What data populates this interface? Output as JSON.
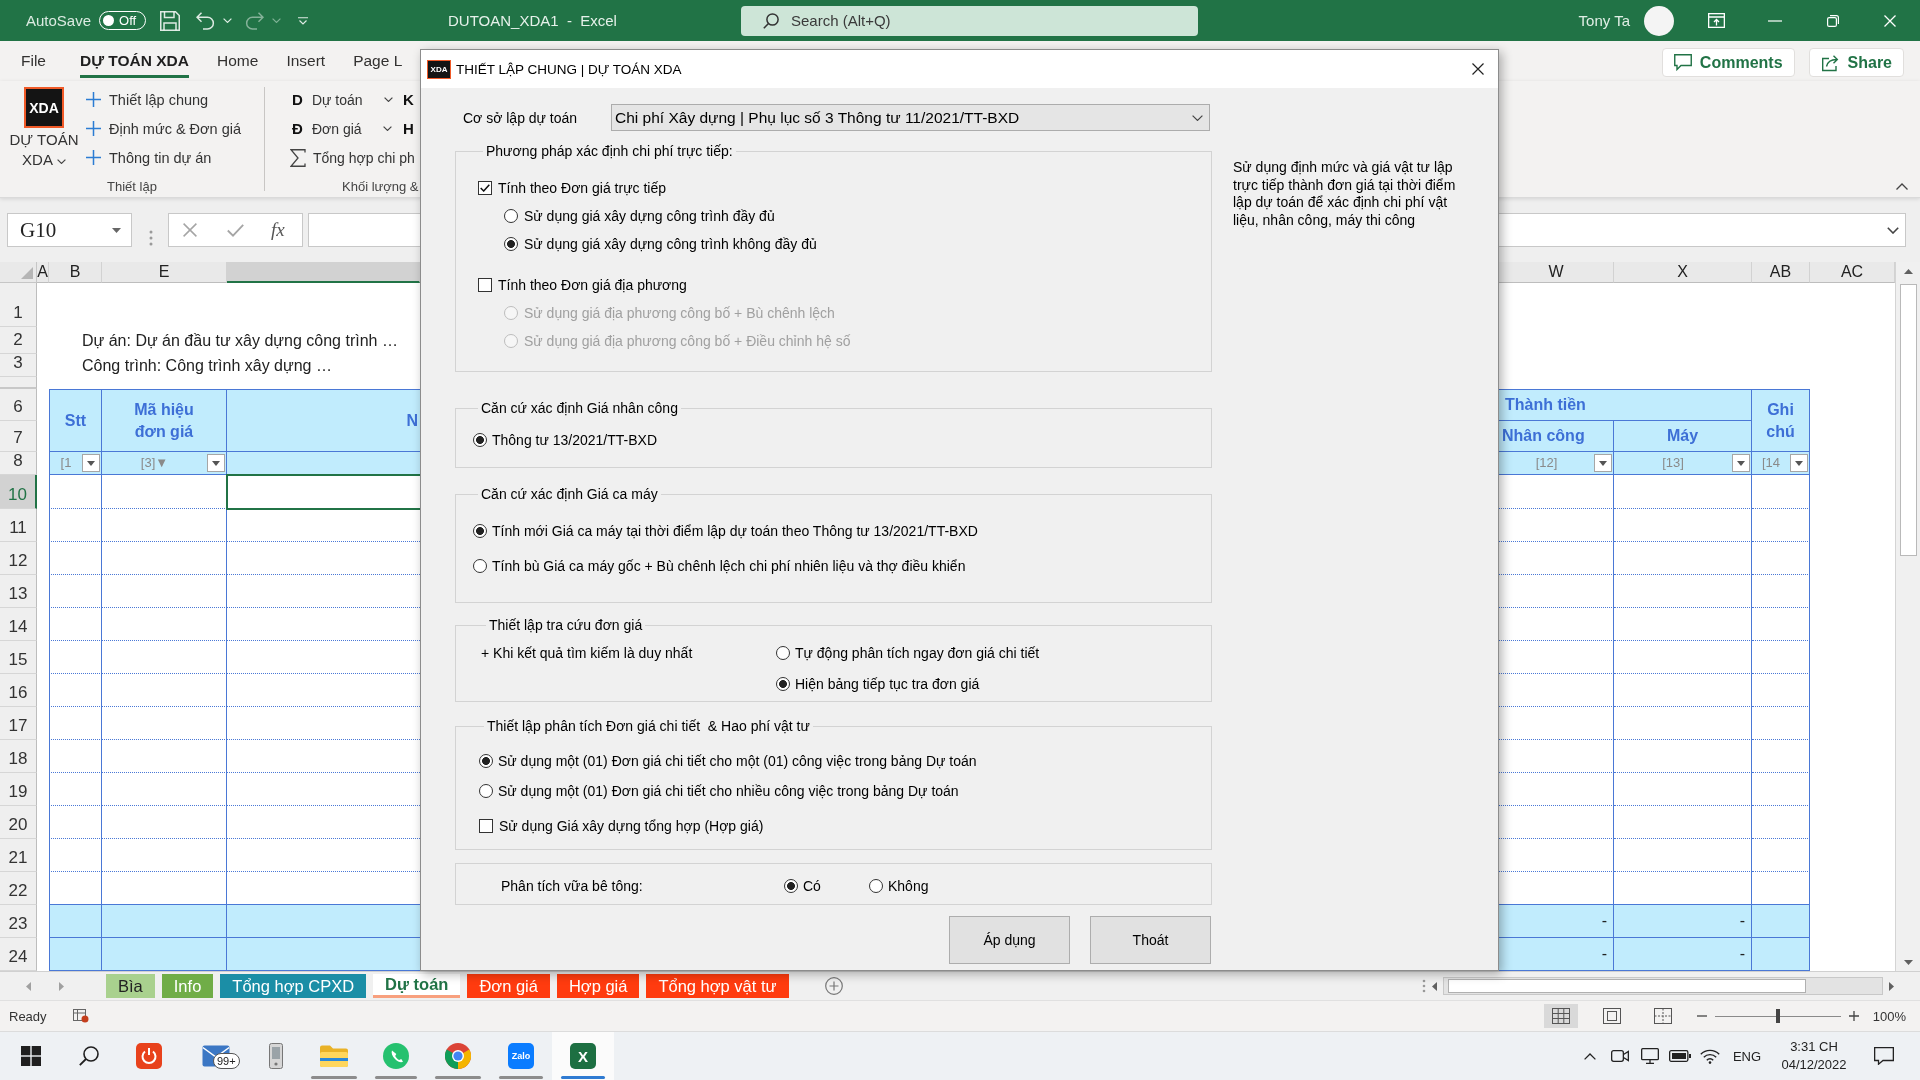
{
  "title_bar": {
    "autosave": {
      "label": "AutoSave",
      "toggle": {
        "label": "Off",
        "on": false
      }
    },
    "title": "DUTOAN_XDA1  -  Excel",
    "search": {
      "placeholder": "Search (Alt+Q)"
    },
    "user": "Tony Ta"
  },
  "ribbon": {
    "tabs": [
      {
        "label": "File",
        "selected": false
      },
      {
        "label": "DỰ TOÁN XDA",
        "selected": true
      },
      {
        "label": "Home",
        "selected": false
      },
      {
        "label": "Insert",
        "selected": false
      },
      {
        "label": "Page L",
        "selected": false
      }
    ],
    "comments_button": "Comments",
    "share_button": "Share",
    "setup_group": {
      "label": "Thiết lập",
      "logo": "XDA",
      "main_button": "DỰ TOÁN XDA",
      "items": [
        "Thiết lập chung",
        "Định mức & Đơn giá",
        "Thông tin dự án"
      ]
    },
    "quantity_group": {
      "label": "Khối lượng &",
      "items": [
        {
          "kind": "letter_menu",
          "letter": "D",
          "label": "Dự toán"
        },
        {
          "kind": "letter_menu",
          "letter": "Đ",
          "label": "Đơn giá"
        },
        {
          "kind": "sum",
          "label": "Tổng hợp chi ph"
        }
      ],
      "next_letters": [
        "K",
        "H"
      ]
    }
  },
  "formula_bar": {
    "name_box": "G10",
    "function_button": "fx"
  },
  "sheet": {
    "column_headers": [
      {
        "label": "A",
        "selected": false
      },
      {
        "label": "B",
        "selected": false
      },
      {
        "label": "E",
        "selected": false
      },
      {
        "selected": true
      },
      {
        "label": "W",
        "selected": false
      },
      {
        "label": "X",
        "selected": false
      },
      {
        "label": "AB",
        "selected": false
      },
      {
        "label": "AC",
        "selected": false
      }
    ],
    "row_headers": [
      {
        "label": "1",
        "selected": false
      },
      {
        "label": "2",
        "selected": false
      },
      {
        "label": "3",
        "selected": false
      },
      {
        "label": "6",
        "selected": false
      },
      {
        "label": "7",
        "selected": false
      },
      {
        "label": "8",
        "selected": false
      },
      {
        "label": "10",
        "selected": true
      },
      {
        "label": "11",
        "selected": false
      },
      {
        "label": "12",
        "selected": false
      },
      {
        "label": "13",
        "selected": false
      },
      {
        "label": "14",
        "selected": false
      },
      {
        "label": "15",
        "selected": false
      },
      {
        "label": "16",
        "selected": false
      },
      {
        "label": "17",
        "selected": false
      },
      {
        "label": "18",
        "selected": false
      },
      {
        "label": "19",
        "selected": false
      },
      {
        "label": "20",
        "selected": false
      },
      {
        "label": "21",
        "selected": false
      },
      {
        "label": "22",
        "selected": false
      },
      {
        "label": "23",
        "selected": false
      },
      {
        "label": "24",
        "selected": false
      }
    ],
    "notes": [
      "Dự án: Dự án đầu tư xây dựng công trình …",
      "Công trình: Công trình xây dựng …"
    ],
    "table": {
      "stt_header": "Stt",
      "code_header": "Mã hiệu đơn giá",
      "task_header": "N",
      "amount_header": "Thành tiền",
      "labor_header": "Nhân công",
      "machine_header": "Máy",
      "note_header": "Ghi chú",
      "column_numbers": [
        "[1",
        "[3]▼",
        "[12]",
        "[13]",
        "[14"
      ],
      "total_rows": [
        {
          "labor": "-",
          "machine": "-"
        },
        {
          "labor": "-",
          "machine": "-"
        }
      ]
    }
  },
  "sheet_tabs": [
    {
      "label": "Bìa",
      "color": "#a9d18e",
      "selected": false
    },
    {
      "label": "Info",
      "color": "#70ad47",
      "selected": false
    },
    {
      "label": "Tổng hợp CPXD",
      "color": "#1b8ea6",
      "selected": false
    },
    {
      "label": "Dự toán",
      "color": "#f8a07e",
      "selected": true
    },
    {
      "label": "Đơn giá",
      "color": "#ff3b0f",
      "selected": false
    },
    {
      "label": "Hợp giá",
      "color": "#ff3b0f",
      "selected": false
    },
    {
      "label": "Tổng hợp vật tư",
      "color": "#ff3b0f",
      "selected": false
    }
  ],
  "status_bar": {
    "status": "Ready",
    "views": [
      {
        "kind": "normal",
        "selected": true
      },
      {
        "kind": "page_layout",
        "selected": false
      },
      {
        "kind": "page_break",
        "selected": false
      }
    ],
    "zoom": {
      "level": 0.5,
      "label": "100%"
    }
  },
  "taskbar": {
    "apps": [
      {
        "kind": "start",
        "running": false,
        "selected": false
      },
      {
        "kind": "search",
        "running": false,
        "selected": false
      },
      {
        "kind": "power",
        "running": false,
        "selected": false
      },
      {
        "kind": "mail",
        "badge": "99+",
        "running": false,
        "selected": false
      },
      {
        "kind": "phone",
        "running": false,
        "selected": false
      },
      {
        "kind": "folder",
        "running": true,
        "selected": false
      },
      {
        "kind": "chat",
        "running": true,
        "selected": false
      },
      {
        "kind": "browser",
        "running": true,
        "selected": false
      },
      {
        "kind": "messenger",
        "glyph": "Zalo",
        "running": true,
        "selected": false
      },
      {
        "kind": "spreadsheet",
        "glyph": "X",
        "running": true,
        "selected": true
      }
    ],
    "language": "ENG",
    "time": "3:31 CH",
    "date": "04/12/2022"
  },
  "dialog": {
    "logo": "XDA",
    "title": "THIẾT LẬP CHUNG | DỰ TOÁN XDA",
    "basis": {
      "label": "Cơ sở lập dự toán",
      "value": "Chi phí Xây dựng | Phụ lục số 3 Thông tư 11/2021/TT-BXD"
    },
    "description": "Sử dụng định mức và giá vật tư lập trực tiếp thành đơn giá tại thời điểm lập dự toán để xác định chi phí vật liệu, nhân công, máy thi công",
    "groups": [
      {
        "kind": "list",
        "legend": "Phương pháp xác định chi phí trực tiếp:",
        "options": [
          {
            "kind": "checkbox",
            "label": "Tính theo Đơn giá trực tiếp",
            "checked": true,
            "disabled": false,
            "children": [
              {
                "kind": "radio",
                "label": "Sử dụng giá xây dựng công trình đầy đủ",
                "selected": false,
                "disabled": false
              },
              {
                "kind": "radio",
                "label": "Sử dụng giá xây dựng công trình không đầy đủ",
                "selected": true,
                "disabled": false
              }
            ]
          },
          {
            "kind": "checkbox",
            "label": "Tính theo Đơn giá địa phương",
            "checked": false,
            "disabled": false,
            "children": [
              {
                "kind": "radio",
                "label": "Sử dụng giá địa phương công bố + Bù chênh lệch",
                "selected": false,
                "disabled": true
              },
              {
                "kind": "radio",
                "label": "Sử dụng giá địa phương công bố + Điều chỉnh hệ số",
                "selected": false,
                "disabled": true
              }
            ]
          }
        ]
      },
      {
        "kind": "list",
        "legend": "Căn cứ xác định Giá nhân công",
        "options": [
          {
            "kind": "radio",
            "label": "Thông tư 13/2021/TT-BXD",
            "selected": true,
            "disabled": false
          }
        ]
      },
      {
        "kind": "list",
        "legend": "Căn cứ xác định Giá ca máy",
        "options": [
          {
            "kind": "radio",
            "label": "Tính mới Giá ca máy tại thời điểm lập dự toán theo Thông tư 13/2021/TT-BXD",
            "selected": true,
            "disabled": false
          },
          {
            "kind": "radio",
            "label": "Tính bù Giá ca máy gốc + Bù chênh lệch chi phí nhiên liệu và thợ điều khiển",
            "selected": false,
            "disabled": false
          }
        ]
      },
      {
        "kind": "prompt_column",
        "legend": "Thiết lập tra cứu đơn giá",
        "prompt": "+ Khi kết quả tìm kiếm là duy nhất",
        "options": [
          {
            "kind": "radio",
            "label": "Tự động phân tích ngay đơn giá chi tiết",
            "selected": false,
            "disabled": false
          },
          {
            "kind": "radio",
            "label": "Hiện bảng tiếp tục tra đơn giá",
            "selected": true,
            "disabled": false
          }
        ]
      },
      {
        "kind": "list",
        "legend": "Thiết lập phân tích Đơn giá chi tiết  & Hao phí vật tư",
        "options": [
          {
            "kind": "radio",
            "label": "Sử dụng một (01) Đơn giá chi tiết cho một (01) công việc trong bảng Dự toán",
            "selected": true,
            "disabled": false
          },
          {
            "kind": "radio",
            "label": "Sử dụng một (01) Đơn giá chi tiết cho nhiều công việc trong bảng Dự toán",
            "selected": false,
            "disabled": false
          },
          {
            "kind": "checkbox",
            "label": "Sử dụng Giá xây dựng tổng hợp (Hợp giá)",
            "checked": false,
            "disabled": false
          }
        ]
      },
      {
        "kind": "prompt_row",
        "prompt": "Phân tích vữa bê tông:",
        "options": [
          {
            "kind": "radio",
            "label": "Có",
            "selected": true,
            "disabled": false
          },
          {
            "kind": "radio",
            "label": "Không",
            "selected": false,
            "disabled": false
          }
        ]
      }
    ],
    "buttons": [
      "Áp dụng",
      "Thoát"
    ]
  }
}
